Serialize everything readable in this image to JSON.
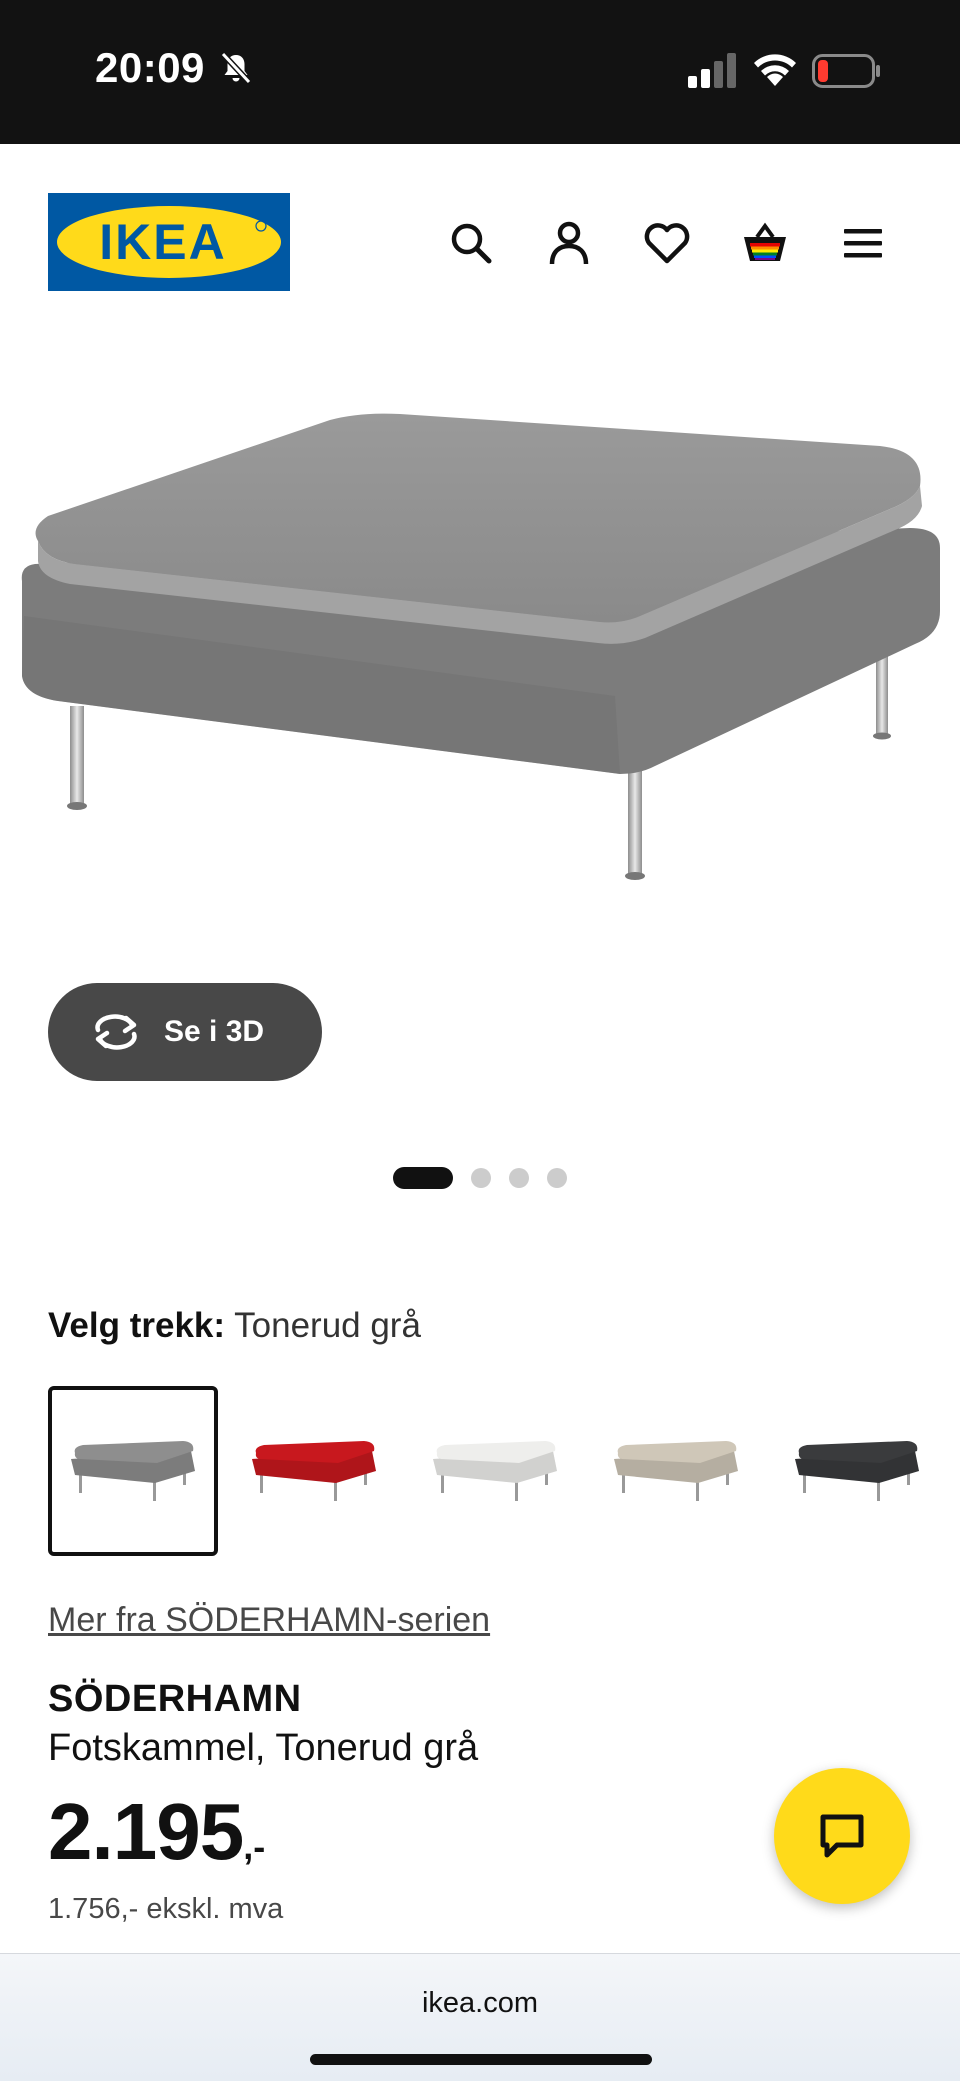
{
  "status_bar": {
    "time": "20:09"
  },
  "header": {
    "logo_text": "IKEA",
    "icons": [
      "search-icon",
      "account-icon",
      "heart-icon",
      "cart-icon",
      "menu-icon"
    ]
  },
  "hero": {
    "see_3d_label": "Se i 3D",
    "gallery_count": 4,
    "gallery_active": 1
  },
  "variant": {
    "label": "Velg trekk:",
    "value": "Tonerud grå",
    "swatches": [
      {
        "name": "Tonerud grå",
        "color": "#8e8e8e",
        "selected": true
      },
      {
        "name": "rød",
        "color": "#c8181e",
        "selected": false
      },
      {
        "name": "hvit",
        "color": "#eeeeec",
        "selected": false
      },
      {
        "name": "beige",
        "color": "#cfc7b8",
        "selected": false
      },
      {
        "name": "mørk grå",
        "color": "#3a3b3d",
        "selected": false
      }
    ]
  },
  "series_link": "Mer fra SÖDERHAMN-serien",
  "product": {
    "name": "SÖDERHAMN",
    "description": "Fotskammel, Tonerud grå",
    "price_integer": "2.195",
    "price_decimal": ",-",
    "price_ex_vat": "1.756,- ekskl. mva"
  },
  "browser": {
    "url": "ikea.com"
  },
  "colors": {
    "ikea_blue": "#0058A3",
    "ikea_yellow": "#FFDA1A",
    "button_dark": "#484848"
  }
}
